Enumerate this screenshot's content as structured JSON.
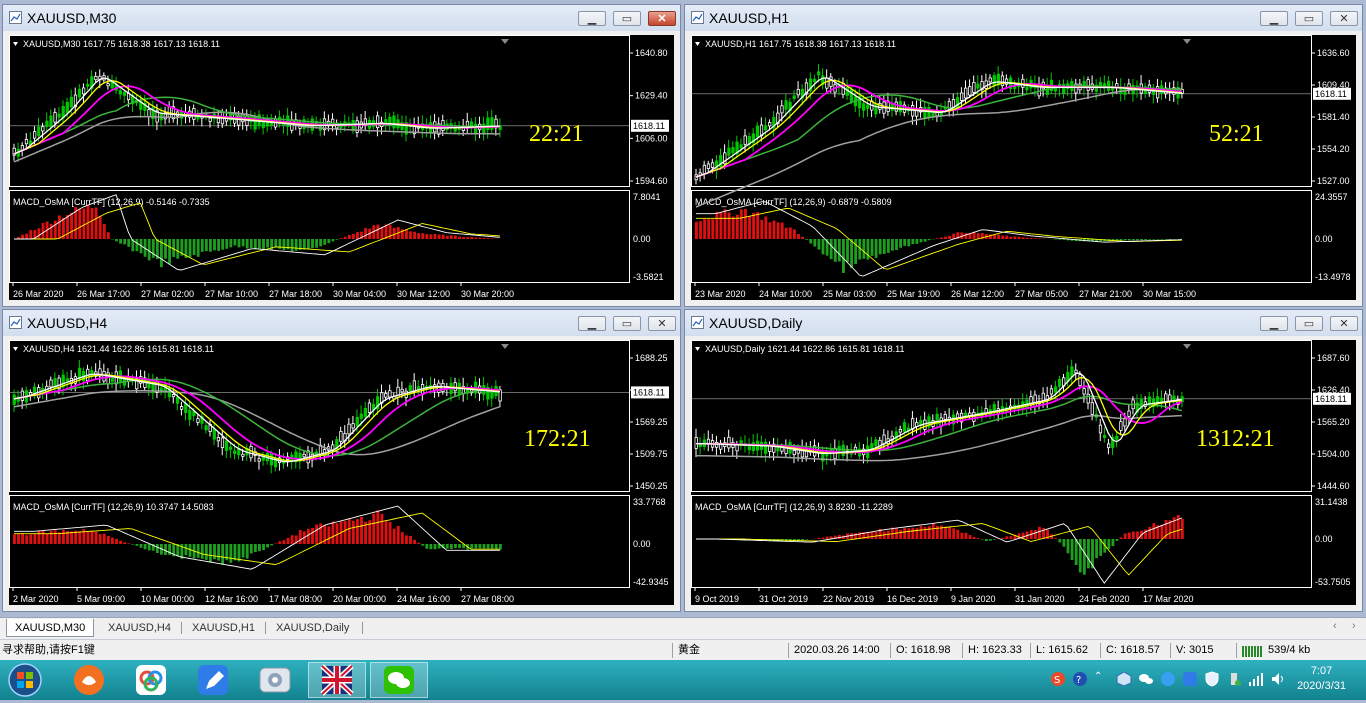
{
  "colors": {
    "bg": "#000000",
    "grid": "#ffffff",
    "axis_text": "#ffffff",
    "bull": "#ffffff",
    "bear": "#00c800",
    "ma_white": "#ffffff",
    "ma_yellow": "#ffff00",
    "ma_magenta": "#ff00ff",
    "ma_green": "#3cb43c",
    "ma_gray": "#a0a0a0",
    "hist_pos": "#e01010",
    "hist_neg": "#1f9e1f",
    "macd_line": "#ffffff",
    "signal_line": "#ffff00",
    "timer": "#ffff00"
  },
  "windows": [
    {
      "title": "XAUUSD,M30",
      "info": "XAUUSD,M30  1617.75 1618.38 1617.13 1618.11",
      "indicator": "MACD_OsMA [CurrTF] (12,26,9) -0.5146 -0.7335",
      "timer": "22:21",
      "price_label": "1618.11",
      "price_ticks": [
        "1640.80",
        "1629.40",
        "1606.00",
        "1594.60"
      ],
      "osc_ticks": [
        "7.8041",
        "0.00",
        "-3.5821"
      ],
      "time_ticks": [
        "26 Mar 2020",
        "26 Mar 17:00",
        "27 Mar 02:00",
        "27 Mar 10:00",
        "27 Mar 18:00",
        "30 Mar 04:00",
        "30 Mar 12:00",
        "30 Mar 20:00"
      ],
      "close_active": true
    },
    {
      "title": "XAUUSD,H1",
      "info": "XAUUSD,H1  1617.75 1618.38 1617.13 1618.11",
      "indicator": "MACD_OsMA [CurrTF] (12,26,9) -0.6879 -0.5809",
      "timer": "52:21",
      "price_label": "1618.11",
      "price_ticks": [
        "1636.60",
        "1609.40",
        "1581.40",
        "1554.20",
        "1527.00"
      ],
      "osc_ticks": [
        "24.3557",
        "0.00",
        "-13.4978"
      ],
      "time_ticks": [
        "23 Mar 2020",
        "24 Mar 10:00",
        "25 Mar 03:00",
        "25 Mar 19:00",
        "26 Mar 12:00",
        "27 Mar 05:00",
        "27 Mar 21:00",
        "30 Mar 15:00"
      ],
      "close_active": false
    },
    {
      "title": "XAUUSD,H4",
      "info": "XAUUSD,H4  1621.44 1622.86 1615.81 1618.11",
      "indicator": "MACD_OsMA [CurrTF] (12,26,9) 10.3747 14.5083",
      "timer": "172:21",
      "price_label": "1618.11",
      "price_ticks": [
        "1688.25",
        "1628.75",
        "1569.25",
        "1509.75",
        "1450.25"
      ],
      "osc_ticks": [
        "33.7768",
        "0.00",
        "-42.9345"
      ],
      "time_ticks": [
        "2 Mar 2020",
        "5 Mar 09:00",
        "10 Mar 00:00",
        "12 Mar 16:00",
        "17 Mar 08:00",
        "20 Mar 00:00",
        "24 Mar 16:00",
        "27 Mar 08:00"
      ],
      "close_active": false
    },
    {
      "title": "XAUUSD,Daily",
      "info": "XAUUSD,Daily  1621.44 1622.86 1615.81 1618.11",
      "indicator": "MACD_OsMA [CurrTF] (12,26,9) 3.8230 -11.2289",
      "timer": "1312:21",
      "price_label": "1618.11",
      "price_ticks": [
        "1687.60",
        "1626.40",
        "1565.20",
        "1504.00",
        "1444.60"
      ],
      "osc_ticks": [
        "31.1438",
        "0.00",
        "-53.7505"
      ],
      "time_ticks": [
        "9 Oct 2019",
        "31 Oct 2019",
        "22 Nov 2019",
        "16 Dec 2019",
        "9 Jan 2020",
        "31 Jan 2020",
        "24 Feb 2020",
        "17 Mar 2020"
      ],
      "close_active": false
    }
  ],
  "tabs": [
    "XAUUSD,M30",
    "XAUUSD,H4",
    "XAUUSD,H1",
    "XAUUSD,Daily"
  ],
  "status": {
    "help": "寻求帮助,请按F1键",
    "profile": "黄金",
    "datetime": "2020.03.26 14:00",
    "open": "O: 1618.98",
    "high": "H: 1623.33",
    "low": "L: 1615.62",
    "close": "C: 1618.57",
    "volume": "V: 3015",
    "traffic": "539/4 kb"
  },
  "taskbar": {
    "time": "7:07",
    "date": "2020/3/31",
    "apps": [
      "start-orb",
      "uc-browser-icon",
      "baidu-netdisk-icon",
      "feishu-icon",
      "cleaner-icon",
      "metatrader-icon",
      "wechat-icon"
    ]
  }
}
